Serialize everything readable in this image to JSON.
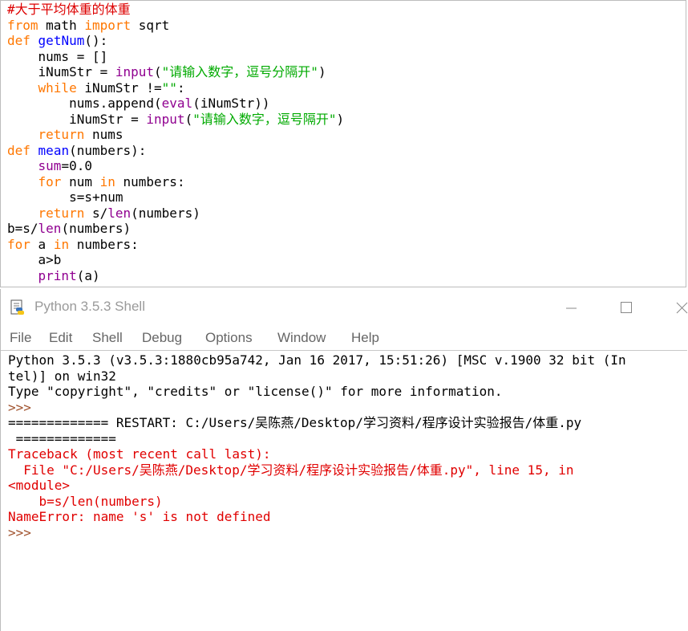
{
  "editor": {
    "lines": [
      [
        {
          "t": "#大于平均体重的体重",
          "c": "cm"
        }
      ],
      [
        {
          "t": "from",
          "c": "kw"
        },
        {
          "t": " math ",
          "c": ""
        },
        {
          "t": "import",
          "c": "kw"
        },
        {
          "t": " sqrt",
          "c": ""
        }
      ],
      [
        {
          "t": "def",
          "c": "kw"
        },
        {
          "t": " ",
          "c": ""
        },
        {
          "t": "getNum",
          "c": "fn"
        },
        {
          "t": "():",
          "c": ""
        }
      ],
      [
        {
          "t": "    nums = []",
          "c": ""
        }
      ],
      [
        {
          "t": "    iNumStr = ",
          "c": ""
        },
        {
          "t": "input",
          "c": "bi"
        },
        {
          "t": "(",
          "c": ""
        },
        {
          "t": "\"请输入数字，逗号分隔开\"",
          "c": "st"
        },
        {
          "t": ")",
          "c": ""
        }
      ],
      [
        {
          "t": "    ",
          "c": ""
        },
        {
          "t": "while",
          "c": "kw"
        },
        {
          "t": " iNumStr !=",
          "c": ""
        },
        {
          "t": "\"\"",
          "c": "st"
        },
        {
          "t": ":",
          "c": ""
        }
      ],
      [
        {
          "t": "        nums.append(",
          "c": ""
        },
        {
          "t": "eval",
          "c": "bi"
        },
        {
          "t": "(iNumStr))",
          "c": ""
        }
      ],
      [
        {
          "t": "        iNumStr = ",
          "c": ""
        },
        {
          "t": "input",
          "c": "bi"
        },
        {
          "t": "(",
          "c": ""
        },
        {
          "t": "\"请输入数字，逗号隔开\"",
          "c": "st"
        },
        {
          "t": ")",
          "c": ""
        }
      ],
      [
        {
          "t": "    ",
          "c": ""
        },
        {
          "t": "return",
          "c": "kw"
        },
        {
          "t": " nums",
          "c": ""
        }
      ],
      [
        {
          "t": "def",
          "c": "kw"
        },
        {
          "t": " ",
          "c": ""
        },
        {
          "t": "mean",
          "c": "fn"
        },
        {
          "t": "(numbers):",
          "c": ""
        }
      ],
      [
        {
          "t": "    ",
          "c": ""
        },
        {
          "t": "sum",
          "c": "bi"
        },
        {
          "t": "=0.0",
          "c": ""
        }
      ],
      [
        {
          "t": "    ",
          "c": ""
        },
        {
          "t": "for",
          "c": "kw"
        },
        {
          "t": " num ",
          "c": ""
        },
        {
          "t": "in",
          "c": "kw"
        },
        {
          "t": " numbers:",
          "c": ""
        }
      ],
      [
        {
          "t": "        s=s+num",
          "c": ""
        }
      ],
      [
        {
          "t": "    ",
          "c": ""
        },
        {
          "t": "return",
          "c": "kw"
        },
        {
          "t": " s/",
          "c": ""
        },
        {
          "t": "len",
          "c": "bi"
        },
        {
          "t": "(numbers)",
          "c": ""
        }
      ],
      [
        {
          "t": "b=s/",
          "c": ""
        },
        {
          "t": "len",
          "c": "bi"
        },
        {
          "t": "(numbers)",
          "c": ""
        }
      ],
      [
        {
          "t": "for",
          "c": "kw"
        },
        {
          "t": " a ",
          "c": ""
        },
        {
          "t": "in",
          "c": "kw"
        },
        {
          "t": " numbers:",
          "c": ""
        }
      ],
      [
        {
          "t": "    a>b",
          "c": ""
        }
      ],
      [
        {
          "t": "    ",
          "c": ""
        },
        {
          "t": "print",
          "c": "bi"
        },
        {
          "t": "(a)",
          "c": ""
        }
      ]
    ]
  },
  "shell_window": {
    "title": "Python 3.5.3 Shell",
    "menu": [
      "File",
      "Edit",
      "Shell",
      "Debug",
      "Options",
      "Window",
      "Help"
    ],
    "output_lines": [
      {
        "t": "Python 3.5.3 (v3.5.3:1880cb95a742, Jan 16 2017, 15:51:26) [MSC v.1900 32 bit (In",
        "c": ""
      },
      {
        "t": "tel)] on win32",
        "c": ""
      },
      {
        "t": "Type \"copyright\", \"credits\" or \"license()\" for more information.",
        "c": ""
      },
      {
        "t": ">>>",
        "c": "prompt"
      },
      {
        "t": "============= RESTART: C:/Users/吴陈燕/Desktop/学习资料/程序设计实验报告/体重.py",
        "c": "restart"
      },
      {
        "t": " =============",
        "c": "restart"
      },
      {
        "t": "Traceback (most recent call last):",
        "c": "err"
      },
      {
        "t": "  File \"C:/Users/吴陈燕/Desktop/学习资料/程序设计实验报告/体重.py\", line 15, in",
        "c": "err"
      },
      {
        "t": "<module>",
        "c": "err"
      },
      {
        "t": "    b=s/len(numbers)",
        "c": "err"
      },
      {
        "t": "NameError: name 's' is not defined",
        "c": "err"
      },
      {
        "t": ">>>",
        "c": "prompt"
      }
    ]
  },
  "icons": {
    "app": "python-file-icon",
    "minimize": "minimize-icon",
    "maximize": "maximize-icon",
    "close": "close-icon"
  },
  "colors": {
    "keyword": "#ff7700",
    "builtin": "#900090",
    "definition": "#0000ff",
    "string": "#00aa00",
    "comment": "#dd0000",
    "error": "#e00000",
    "prompt": "#a0522d"
  }
}
